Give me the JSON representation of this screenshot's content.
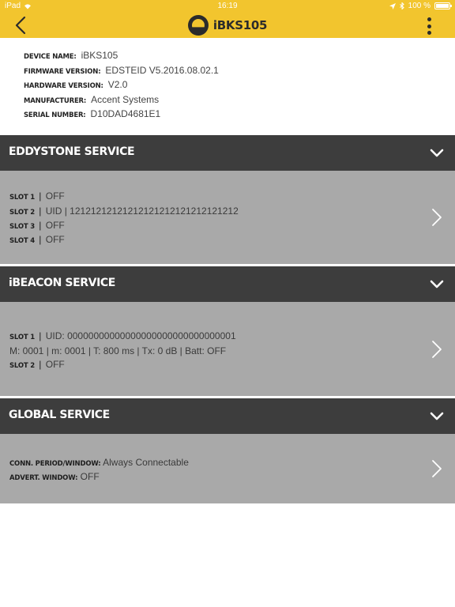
{
  "status_bar": {
    "carrier": "iPad",
    "time": "16:19",
    "battery": "100 %"
  },
  "nav": {
    "title": "iBKS105"
  },
  "device_info": [
    {
      "label": "DEVICE NAME:",
      "value": "iBKS105"
    },
    {
      "label": "FIRMWARE VERSION:",
      "value": "EDSTEID V5.2016.08.02.1"
    },
    {
      "label": "HARDWARE VERSION:",
      "value": "V2.0"
    },
    {
      "label": "MANUFACTURER:",
      "value": "Accent Systems"
    },
    {
      "label": "SERIAL NUMBER:",
      "value": "D10DAD4681E1"
    }
  ],
  "eddystone": {
    "title": "EDDYSTONE SERVICE",
    "slots": [
      {
        "label": "SLOT 1",
        "value": "OFF"
      },
      {
        "label": "SLOT 2",
        "value": "UID | 12121212121212121212121212121212"
      },
      {
        "label": "SLOT 3",
        "value": "OFF"
      },
      {
        "label": "SLOT 4",
        "value": "OFF"
      }
    ]
  },
  "ibeacon": {
    "title": "iBEACON SERVICE",
    "slot1_label": "SLOT 1",
    "slot1_value": "UID: 00000000000000000000000000000001",
    "slot1_details": "M: 0001 | m: 0001 | T: 800 ms | Tx: 0 dB | Batt: OFF",
    "slot2_label": "SLOT 2",
    "slot2_value": "OFF"
  },
  "global": {
    "title": "GLOBAL SERVICE",
    "conn_label": "CONN. PERIOD/WINDOW:",
    "conn_value": "Always Connectable",
    "advert_label": "ADVERT. WINDOW:",
    "advert_value": "OFF"
  },
  "icons": {
    "back": "chevron-left-icon",
    "menu": "kebab-menu-icon",
    "expand": "chevron-down-icon",
    "open": "chevron-right-icon"
  },
  "colors": {
    "accent": "#f2c52e",
    "header_dark": "#3d3d3d",
    "body_gray": "#a9a9a9"
  }
}
